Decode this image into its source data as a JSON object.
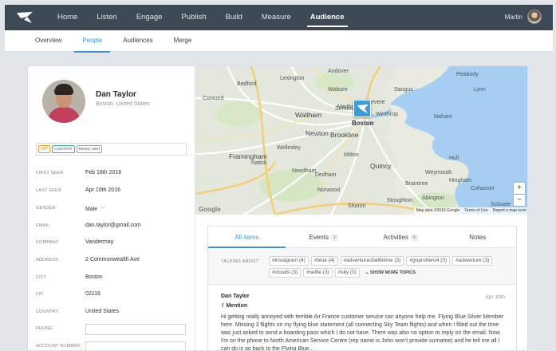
{
  "nav": {
    "items": [
      "Home",
      "Listen",
      "Engage",
      "Publish",
      "Build",
      "Measure",
      "Audience"
    ],
    "active": "Audience"
  },
  "user": {
    "name": "Martin"
  },
  "subnav": {
    "items": [
      "Overview",
      "People",
      "Audiences",
      "Merge"
    ],
    "active": "People"
  },
  "profile": {
    "name": "Dan Taylor",
    "location": "Boston, United States",
    "tags": [
      "VIP",
      "customer",
      "heavy user"
    ],
    "fields": [
      {
        "label": "FIRST SEEN",
        "value": "Feb 18th 2016"
      },
      {
        "label": "LAST SEEN",
        "value": "Apr 10th 2016"
      },
      {
        "label": "GENDER",
        "value": "Male"
      },
      {
        "label": "EMAIL",
        "value": "dan.taylor@gmail.com"
      },
      {
        "label": "COMPANY",
        "value": "Vandermay"
      },
      {
        "label": "ADDRESS",
        "value": "2 Commonwealth Ave"
      },
      {
        "label": "CITY",
        "value": "Boston"
      },
      {
        "label": "ZIP",
        "value": "02116"
      },
      {
        "label": "COUNTRY",
        "value": "United States"
      },
      {
        "label": "PHONE",
        "value": ""
      },
      {
        "label": "ACCOUNT NUMBER",
        "value": ""
      }
    ]
  },
  "map": {
    "places": [
      "Andover",
      "Peabody",
      "Lynn",
      "Concord",
      "Bedford",
      "Woburn",
      "Lexington",
      "Medford",
      "Saugus",
      "Nahant",
      "Revere",
      "Waltham",
      "Somerville",
      "Winthrop",
      "Boston",
      "Newton",
      "Brookline",
      "Framingham",
      "Wellesley",
      "Natick",
      "Needham",
      "Quincy",
      "Dedham",
      "Weymouth",
      "Hingham",
      "Hull",
      "Cohasset",
      "Norwood",
      "Sharon",
      "Stoughton",
      "Braintree",
      "Abington",
      "Scituate",
      "Milton"
    ],
    "attribution": {
      "data": "Map data ©2016 Google",
      "terms": "Terms of Use",
      "report": "Report a map error",
      "google": "Google"
    },
    "zoom_in": "+",
    "zoom_out": "−"
  },
  "feed": {
    "tabs": [
      {
        "label": "All items",
        "count": ""
      },
      {
        "label": "Events",
        "count": "1"
      },
      {
        "label": "Activities",
        "count": "5"
      },
      {
        "label": "Notes",
        "count": ""
      }
    ],
    "active_tab": "All items",
    "topics_label": "TALKING ABOUT",
    "topics": [
      "#instagram (4)",
      "#blue (4)",
      "#adventureofalifetime (3)",
      "#gopro­hero4 (3)",
      "#adventure (3)",
      "#clouds (3)",
      "#selfie (3)",
      "#sky (3)"
    ],
    "show_more": "SHOW MORE TOPICS",
    "post": {
      "author": "Dan Taylor",
      "source": "Mention",
      "date": "Apr 10th",
      "text": "Hi getting really annoyed with terrible Air France customer service can anyone help me. Flying Blue Silver Member here. Missing 3 flights on my flying blue statement (all connecting Sky Team flights) and when I filled out the time was just asked to send a boarding pass which I do not have. There was also no option to reply on the email. Now I'm on the phone to North American Service Centre (rep name is John won't provide surname) and he tell me all I can do is go back to the Flying Blue..."
    }
  }
}
